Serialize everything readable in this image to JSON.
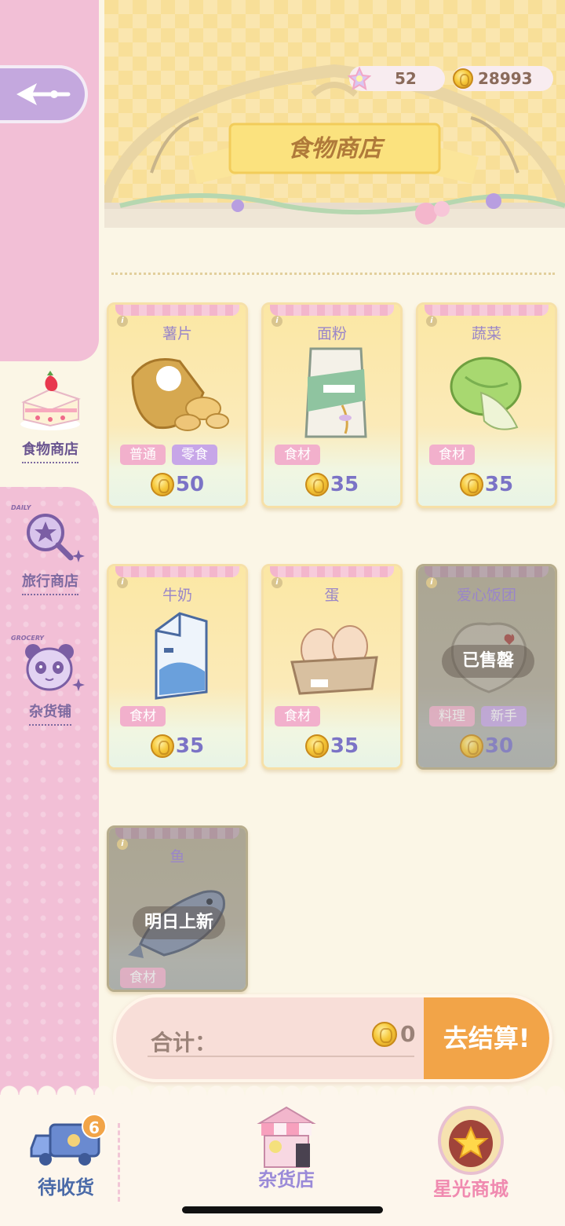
{
  "currency": {
    "stars": "52",
    "coins": "28993"
  },
  "shop": {
    "title": "食物商店"
  },
  "sidebar": {
    "items": [
      {
        "label": "食物商店",
        "tag": ""
      },
      {
        "label": "旅行商店",
        "tag": "DAILY"
      },
      {
        "label": "杂货铺",
        "tag": "GROCERY"
      }
    ]
  },
  "products": [
    {
      "name": "薯片",
      "tags": [
        "普通",
        "零食"
      ],
      "price": "50",
      "status": ""
    },
    {
      "name": "面粉",
      "tags": [
        "食材"
      ],
      "price": "35",
      "status": ""
    },
    {
      "name": "蔬菜",
      "tags": [
        "食材"
      ],
      "price": "35",
      "status": ""
    },
    {
      "name": "牛奶",
      "tags": [
        "食材"
      ],
      "price": "35",
      "status": ""
    },
    {
      "name": "蛋",
      "tags": [
        "食材"
      ],
      "price": "35",
      "status": ""
    },
    {
      "name": "爱心饭团",
      "tags": [
        "料理",
        "新手"
      ],
      "price": "30",
      "status": "已售罄"
    },
    {
      "name": "鱼",
      "tags": [
        "食材"
      ],
      "price": "",
      "status": "明日上新"
    }
  ],
  "checkout": {
    "total_label": "合计：",
    "total_value": "0",
    "button": "去结算!"
  },
  "bottom_nav": {
    "pending": {
      "label": "待收货",
      "badge": "6"
    },
    "grocery": {
      "label": "杂货店"
    },
    "starlight": {
      "label": "星光商城"
    }
  },
  "colors": {
    "accent": "#f2a448",
    "sidebar": "#f2bfd6",
    "price": "#7b73c6",
    "tag_pink": "#f2b0cc",
    "tag_purple": "#c7a6e8"
  }
}
